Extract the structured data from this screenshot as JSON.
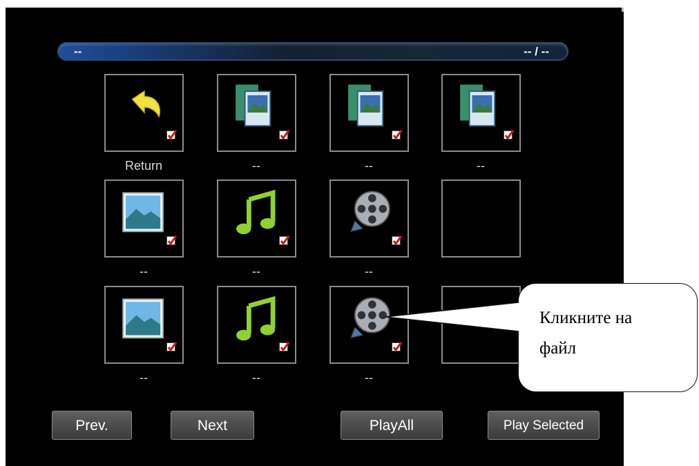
{
  "header": {
    "title": "--",
    "page_counter": "-- / --"
  },
  "grid": [
    {
      "label": "Return",
      "type": "return",
      "checked": true
    },
    {
      "label": "--",
      "type": "folder",
      "checked": true
    },
    {
      "label": "--",
      "type": "folder",
      "checked": true
    },
    {
      "label": "--",
      "type": "folder",
      "checked": true
    },
    {
      "label": "--",
      "type": "image",
      "checked": true
    },
    {
      "label": "--",
      "type": "music",
      "checked": true
    },
    {
      "label": "--",
      "type": "video",
      "checked": true
    },
    {
      "label": "",
      "type": "empty",
      "checked": false
    },
    {
      "label": "--",
      "type": "image",
      "checked": true
    },
    {
      "label": "--",
      "type": "music",
      "checked": true
    },
    {
      "label": "--",
      "type": "video",
      "checked": true
    },
    {
      "label": "",
      "type": "empty",
      "checked": false
    }
  ],
  "buttons": {
    "prev": "Prev.",
    "next": "Next",
    "play_all": "PlayAll",
    "play_selected": "Play Selected"
  },
  "callout": {
    "line1": "Кликните на",
    "line2": "файл"
  },
  "colors": {
    "checkmark": "#d01818",
    "music_note": "#8fd230",
    "return_arrow": "#f0e040",
    "tile_border": "#8c8c8c"
  }
}
